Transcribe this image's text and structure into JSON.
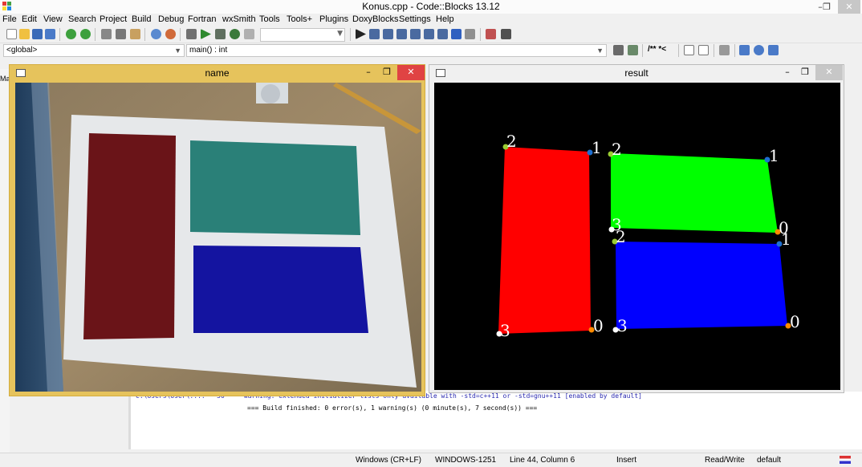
{
  "app": {
    "title": "Konus.cpp - Code::Blocks 13.12",
    "minimize": "–",
    "restore": "❐",
    "close": "✕"
  },
  "menu": [
    "File",
    "Edit",
    "View",
    "Search",
    "Project",
    "Build",
    "Debug",
    "Fortran",
    "wxSmith",
    "Tools",
    "Tools+",
    "Plugins",
    "DoxyBlocks",
    "Settings",
    "Help"
  ],
  "toolbar": {
    "scope_value": "<global>",
    "function_value": "main() : int",
    "comment_tokens": "/** *<"
  },
  "sidebar": {
    "tab_label": "Ma"
  },
  "log": {
    "warning_line": "C:\\Users\\User\\...:   50     warning: extended initializer lists only available with -std=c++11 or -std=gnu++11 [enabled by default]",
    "build_finished": "=== Build finished: 0 error(s), 1 warning(s) (0 minute(s), 7 second(s)) ==="
  },
  "statusbar": {
    "line_endings": "Windows (CR+LF)",
    "encoding": "WINDOWS-1251",
    "position": "Line 44, Column 6",
    "mode": "Insert",
    "access": "Read/Write",
    "profile": "default"
  },
  "windows": {
    "name": {
      "title": "name",
      "minimize": "–",
      "restore": "❐",
      "close": "✕"
    },
    "result": {
      "title": "result",
      "minimize": "–",
      "restore": "❐",
      "close": "✕",
      "labels": {
        "red": [
          "2",
          "1",
          "3",
          "0"
        ],
        "green": [
          "2",
          "1",
          "3",
          "0"
        ],
        "blue": [
          "2",
          "1",
          "3",
          "0"
        ]
      }
    }
  },
  "colors": {
    "accent_title_active": "#e6c35c",
    "close_red": "#e04343",
    "shape_red": "#ff0000",
    "shape_green": "#00ff00",
    "shape_blue": "#0000ff"
  }
}
